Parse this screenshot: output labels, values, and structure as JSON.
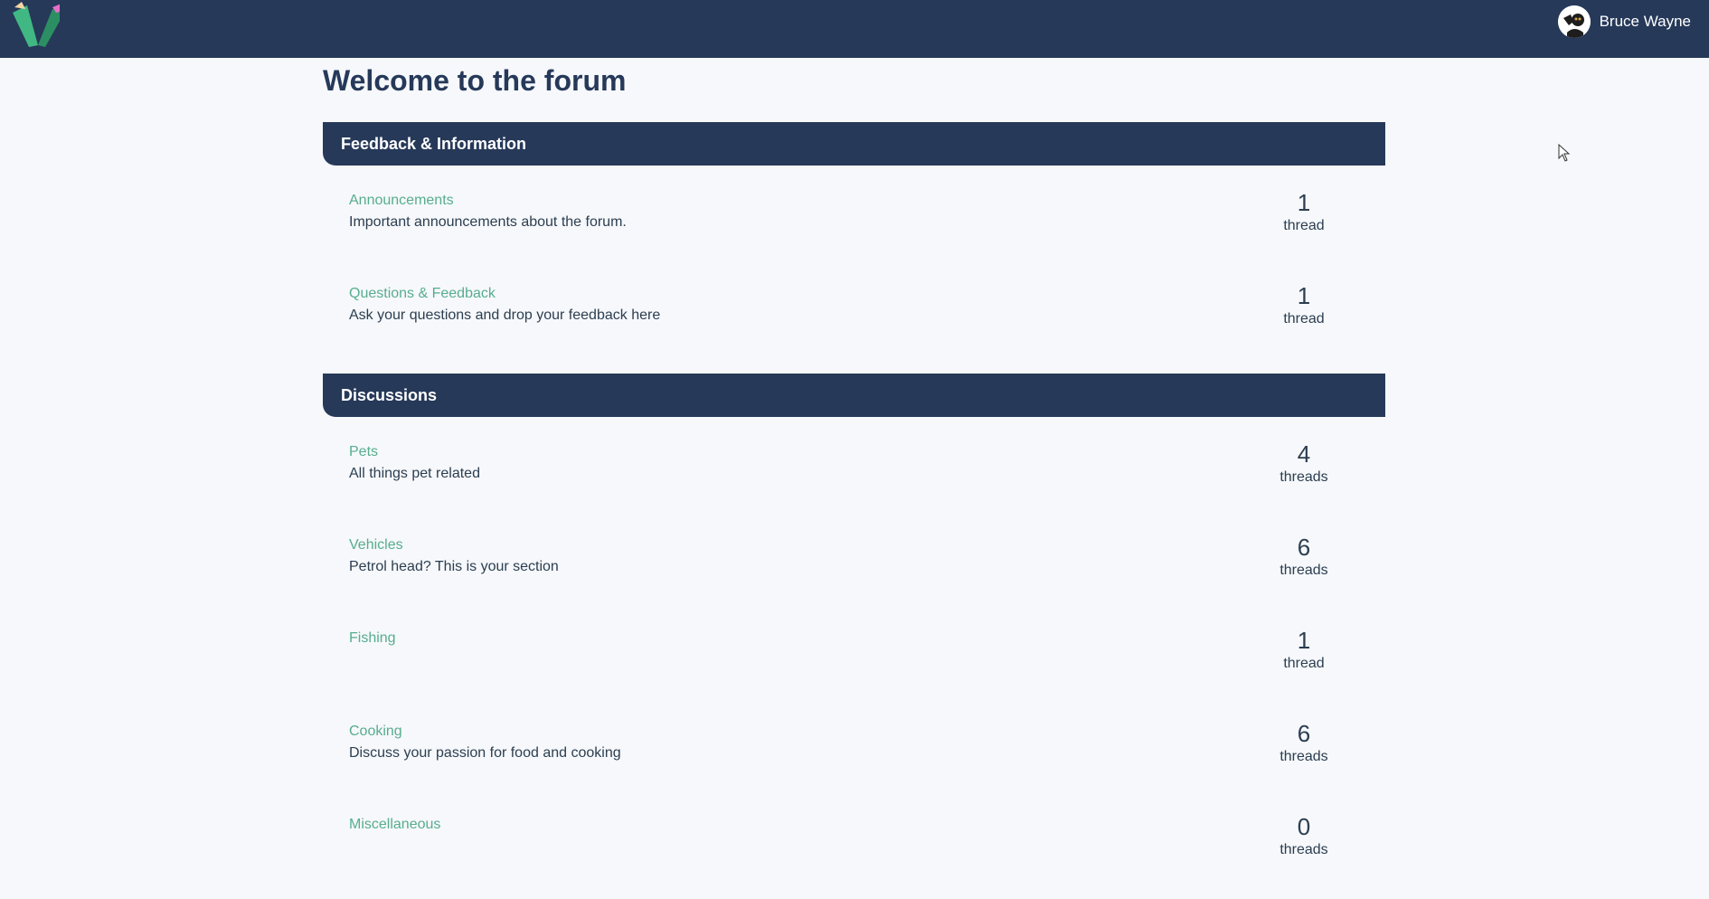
{
  "nav": {
    "user_name": "Bruce Wayne"
  },
  "page_title": "Welcome to the forum",
  "categories": [
    {
      "title": "Feedback & Information",
      "forums": [
        {
          "name": "Announcements",
          "description": "Important announcements about the forum.",
          "count": "1",
          "count_label": "thread"
        },
        {
          "name": "Questions & Feedback",
          "description": "Ask your questions and drop your feedback here",
          "count": "1",
          "count_label": "thread"
        }
      ]
    },
    {
      "title": "Discussions",
      "forums": [
        {
          "name": "Pets",
          "description": "All things pet related",
          "count": "4",
          "count_label": "threads"
        },
        {
          "name": "Vehicles",
          "description": "Petrol head? This is your section",
          "count": "6",
          "count_label": "threads"
        },
        {
          "name": "Fishing",
          "description": "",
          "count": "1",
          "count_label": "thread"
        },
        {
          "name": "Cooking",
          "description": "Discuss your passion for food and cooking",
          "count": "6",
          "count_label": "threads"
        },
        {
          "name": "Miscellaneous",
          "description": "",
          "count": "0",
          "count_label": "threads"
        }
      ]
    }
  ],
  "colors": {
    "navbar": "#263959",
    "link": "#57ad8d",
    "background": "#f6f8fb"
  },
  "icons": {
    "logo": "vue-school-logo-icon",
    "avatar": "user-avatar-icon"
  }
}
